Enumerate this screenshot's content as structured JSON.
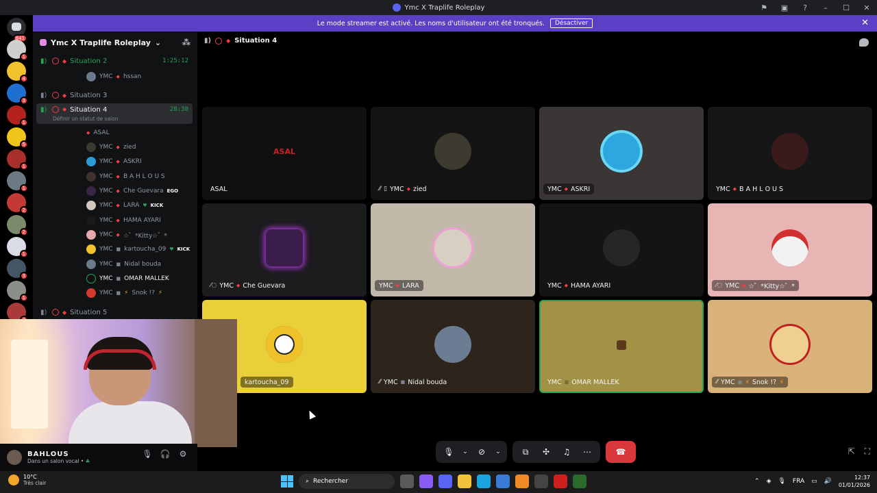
{
  "window": {
    "title": "Ymc X Traplife Roleplay"
  },
  "banner": {
    "text": "Le mode streamer est activé. Les noms d'utilisateur ont été tronqués.",
    "button": "Désactiver"
  },
  "servers": {
    "home_badge": "841",
    "badges": [
      "1",
      "4",
      "3",
      "1",
      "5",
      "1",
      "1",
      "2",
      "2",
      "1",
      "3",
      "1",
      "2"
    ]
  },
  "guild": {
    "name": "Ymc X Traplife Roleplay"
  },
  "channels": [
    {
      "name": "Situation 2",
      "time": "1:25:12"
    },
    {
      "name": "Situation 3"
    },
    {
      "name": "Situation 4",
      "time": "28:30",
      "status": "Définir un statut de salon"
    },
    {
      "name": "Situation 5"
    }
  ],
  "channel_users_s2": [
    {
      "prefix": "YMC",
      "name": "hssan"
    }
  ],
  "channel_users_s4": [
    {
      "prefix": "",
      "name": "ASAL"
    },
    {
      "prefix": "YMC",
      "name": "zied"
    },
    {
      "prefix": "YMC",
      "name": "ASKRI"
    },
    {
      "prefix": "YMC",
      "name": "B A H L O U S"
    },
    {
      "prefix": "YMC",
      "name": "Che Guevara",
      "tag": "EGO"
    },
    {
      "prefix": "YMC",
      "name": "LARA",
      "tag": "KICK"
    },
    {
      "prefix": "YMC",
      "name": "HAMA AYARI"
    },
    {
      "prefix": "YMC",
      "name": "☆゛*Kitty☆゛*"
    },
    {
      "prefix": "YMC",
      "name": "kartoucha_09",
      "tag": "KICK"
    },
    {
      "prefix": "YMC",
      "name": "Nidal bouda"
    },
    {
      "prefix": "YMC",
      "name": "OMAR MALLEK"
    },
    {
      "prefix": "YMC",
      "name": "Snok !?"
    }
  ],
  "self": {
    "name": "BAHLOUS",
    "status": "Dans un salon vocal •"
  },
  "stage": {
    "channel": "Situation 4"
  },
  "tiles": [
    {
      "prefix": "",
      "name": "ASAL",
      "avatar_text": "ASAL"
    },
    {
      "prefix": "YMC",
      "name": "zied"
    },
    {
      "prefix": "YMC",
      "name": "ASKRI"
    },
    {
      "prefix": "YMC",
      "name": "B A H L O U S"
    },
    {
      "prefix": "YMC",
      "name": "Che Guevara"
    },
    {
      "prefix": "YMC",
      "name": "LARA"
    },
    {
      "prefix": "YMC",
      "name": "HAMA AYARI"
    },
    {
      "prefix": "YMC",
      "name": "☆゛*Kitty☆゛*"
    },
    {
      "prefix": "",
      "name": "kartoucha_09"
    },
    {
      "prefix": "YMC",
      "name": "Nidal bouda"
    },
    {
      "prefix": "YMC",
      "name": "OMAR MALLEK"
    },
    {
      "prefix": "YMC",
      "name": "Snok !?"
    }
  ],
  "taskbar": {
    "temp": "10°C",
    "weather": "Très clair",
    "search": "Rechercher",
    "lang": "FRA",
    "time": "12:37",
    "date": "01/01/2026"
  },
  "colors": {
    "accent": "#5b3fc4",
    "danger": "#da373c",
    "speaking": "#23a55a"
  }
}
